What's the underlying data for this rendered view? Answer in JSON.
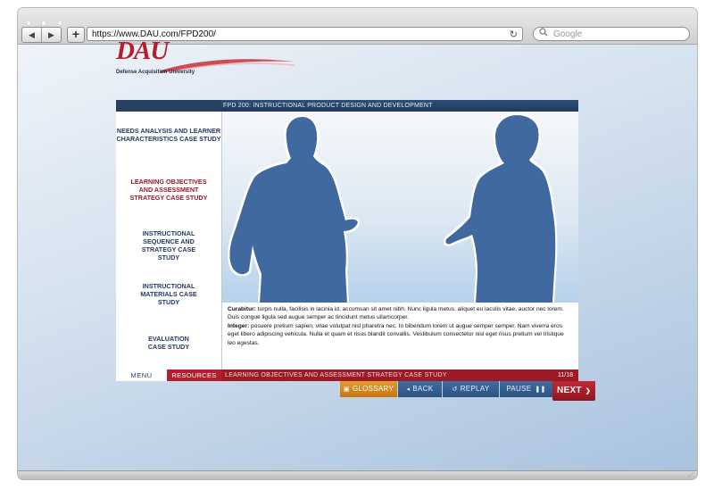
{
  "browser": {
    "url": "https://www.DAU.com/FPD200/",
    "search_placeholder": "Google",
    "back_icon": "◀",
    "forward_icon": "▶",
    "new_tab_icon": "+",
    "reload_icon": "↻"
  },
  "logo": {
    "wordmark": "DAU",
    "subtitle": "Defense Acquisition University"
  },
  "course": {
    "title": "FPD 200: INSTRUCTIONAL PRODUCT DESIGN AND DEVELOPMENT"
  },
  "menu": {
    "items": [
      {
        "label": "NEEDS ANALYSIS AND LEARNER CHARACTERISTICS CASE STUDY"
      },
      {
        "label": "LEARNING OBJECTIVES AND ASSESSMENT STRATEGY CASE STUDY"
      },
      {
        "label": "INSTRUCTIONAL SEQUENCE AND STRATEGY CASE STUDY"
      },
      {
        "label": "INSTRUCTIONAL MATERIALS CASE STUDY"
      },
      {
        "label": "EVALUATION CASE STUDY"
      }
    ],
    "active_index": 1
  },
  "content": {
    "para1_lead": "Curabitur:",
    "para1_text": " turpis nulla, facilisis in lacinia id, accumsan sit amet nibh. Nunc ligula metus, aliquet eu iaculis vitae, auctor nec lorem. Duis congue ligula sed augue semper ac tincidunt metus ullamcorper.",
    "para2_lead": "Integer:",
    "para2_text": " posuere pretium sapien, vitae volutpat nisl pharetra nec. In bibendum lorem ut augue semper semper. Nam viverra eros eget libero adipiscing vehicula. Nulla et quam et risus blandit convallis. Vestibulum consectetur nisl eget risus pretium vel tristique leo egestas."
  },
  "bottombar": {
    "menu_tab": "MENU",
    "resources_tab": "RESOURCES",
    "breadcrumb": "LEARNING OBJECTIVES AND ASSESSMENT STRATEGY CASE STUDY",
    "page_indicator": "11/18"
  },
  "controls": {
    "glossary": "GLOSSARY",
    "back": "BACK",
    "replay": "REPLAY",
    "pause": "PAUSE",
    "next": "NEXT"
  },
  "colors": {
    "brand_red": "#b51f2c",
    "navy": "#27405f",
    "button_blue": "#2d527f",
    "glossary_orange": "#d7881f"
  }
}
